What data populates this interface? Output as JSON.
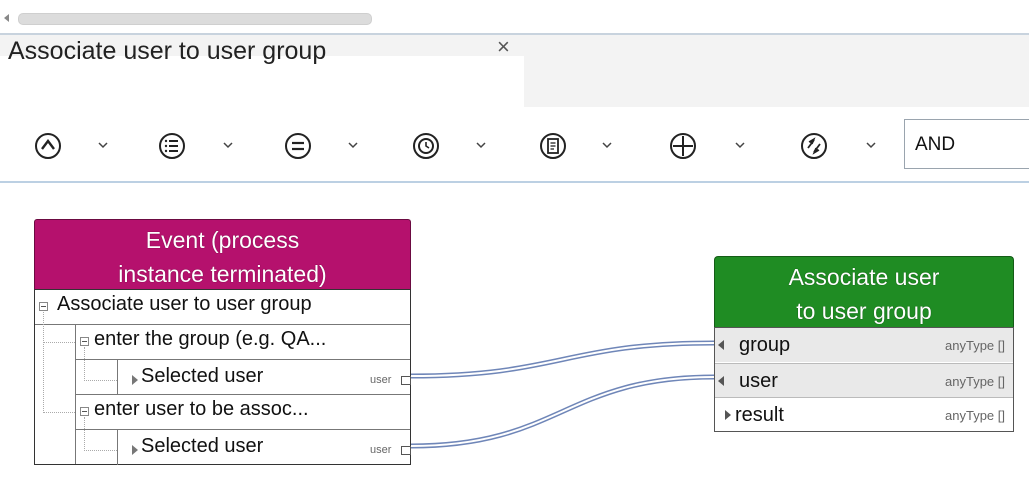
{
  "tab": {
    "title": "Associate user to user group",
    "close_glyph": "×"
  },
  "toolbar": {
    "icons": [
      "caret-up-circle-icon",
      "list-circle-icon",
      "equals-circle-icon",
      "clock-circle-icon",
      "document-circle-icon",
      "plus-circle-icon",
      "arrows-circle-icon"
    ],
    "operator_value": "AND"
  },
  "event_node": {
    "title_line1": "Event (process",
    "title_line2": "instance terminated)",
    "root_label": "Associate user to user group",
    "groups": [
      {
        "label": "enter the group (e.g. QA...",
        "child_label": "Selected user",
        "child_type": "user"
      },
      {
        "label": "enter user to be assoc...",
        "child_label": "Selected user",
        "child_type": "user"
      }
    ],
    "header_color": "#b5116d"
  },
  "action_node": {
    "title_line1": "Associate user",
    "title_line2": "to user group",
    "header_color": "#1f8c23",
    "params": [
      {
        "label": "group",
        "type": "anyType []",
        "direction": "in"
      },
      {
        "label": "user",
        "type": "anyType []",
        "direction": "in"
      },
      {
        "label": "result",
        "type": "anyType []",
        "direction": "out"
      }
    ]
  }
}
